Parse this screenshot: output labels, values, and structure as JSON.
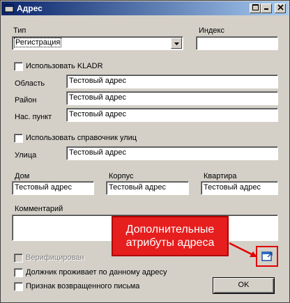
{
  "window": {
    "title": "Адрес",
    "minimize_icon": "minimize-icon",
    "maximize_icon": "maximize-icon",
    "close_icon": "close-icon"
  },
  "type": {
    "label": "Тип",
    "value": "Регистрация"
  },
  "index": {
    "label": "Индекс",
    "value": ""
  },
  "kladr": {
    "label": "Использовать KLADR",
    "checked": false
  },
  "region": {
    "label": "Область",
    "value": "Тестовый адрес"
  },
  "district": {
    "label": "Район",
    "value": "Тестовый адрес"
  },
  "settlement": {
    "label": "Нас. пункт",
    "value": "Тестовый адрес"
  },
  "street_directory": {
    "label": "Использовать справочник улиц",
    "checked": false
  },
  "street": {
    "label": "Улица",
    "value": "Тестовый адрес"
  },
  "house": {
    "label": "Дом",
    "value": "Тестовый адрес"
  },
  "building": {
    "label": "Корпус",
    "value": "Тестовый адрес"
  },
  "apartment": {
    "label": "Квартира",
    "value": "Тестовый адрес"
  },
  "comment": {
    "label": "Комментарий",
    "value": ""
  },
  "verified": {
    "label": "Верифицирован",
    "checked": false,
    "disabled": true
  },
  "debtor_lives": {
    "label": "Должник проживает по данному адресу",
    "checked": false
  },
  "returned_letter": {
    "label": "Признак возвращенного письма",
    "checked": false
  },
  "callout": {
    "line1": "Дополнительные",
    "line2": "атрибуты адреса",
    "color": "#e61e1e"
  },
  "ok_button": {
    "label": "OK"
  }
}
